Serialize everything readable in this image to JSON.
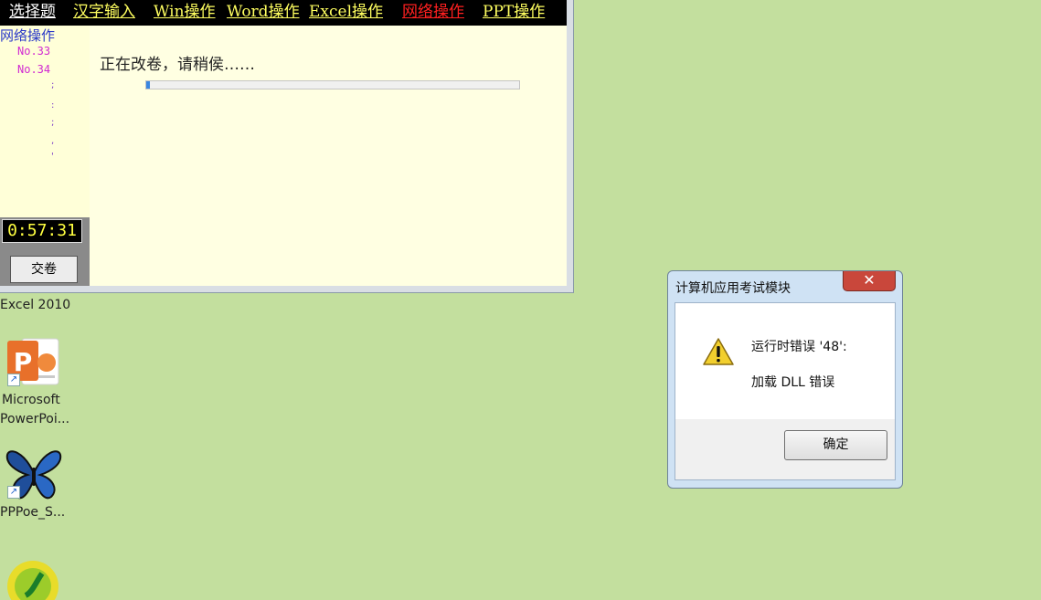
{
  "desktop": {
    "icons": [
      {
        "label_lines": [
          "Excel 2010"
        ],
        "name": "excel-icon"
      },
      {
        "label_lines": [
          "Microsoft",
          "PowerPoi..."
        ],
        "name": "powerpoint-icon"
      },
      {
        "label_lines": [
          "PPPoe_S..."
        ],
        "name": "butterfly-icon"
      },
      {
        "label_lines": [],
        "name": "music-player-icon"
      }
    ]
  },
  "exam_window": {
    "menu": [
      {
        "label": "选择题",
        "color": "#ffffff"
      },
      {
        "label": "汉字输入",
        "color": "#ffff60"
      },
      {
        "label": "Win操作",
        "color": "#ffff60"
      },
      {
        "label": "Word操作",
        "color": "#ffff60"
      },
      {
        "label": "Excel操作",
        "color": "#ffff60"
      },
      {
        "label": "网络操作",
        "color": "#ff2020"
      },
      {
        "label": "PPT操作",
        "color": "#ffff60"
      }
    ],
    "sidebar": {
      "title": "网络操作",
      "items": [
        "No.33",
        "No.34"
      ]
    },
    "timer": "0:57:31",
    "submit_label": "交卷",
    "status_text": "正在改卷，请稍侯……",
    "progress": 0.01
  },
  "dialog": {
    "title": "计算机应用考试模块",
    "close_glyph": "✕",
    "message_line1": "运行时错误 '48':",
    "message_line2": "加载 DLL 错误",
    "ok_label": "确定"
  }
}
